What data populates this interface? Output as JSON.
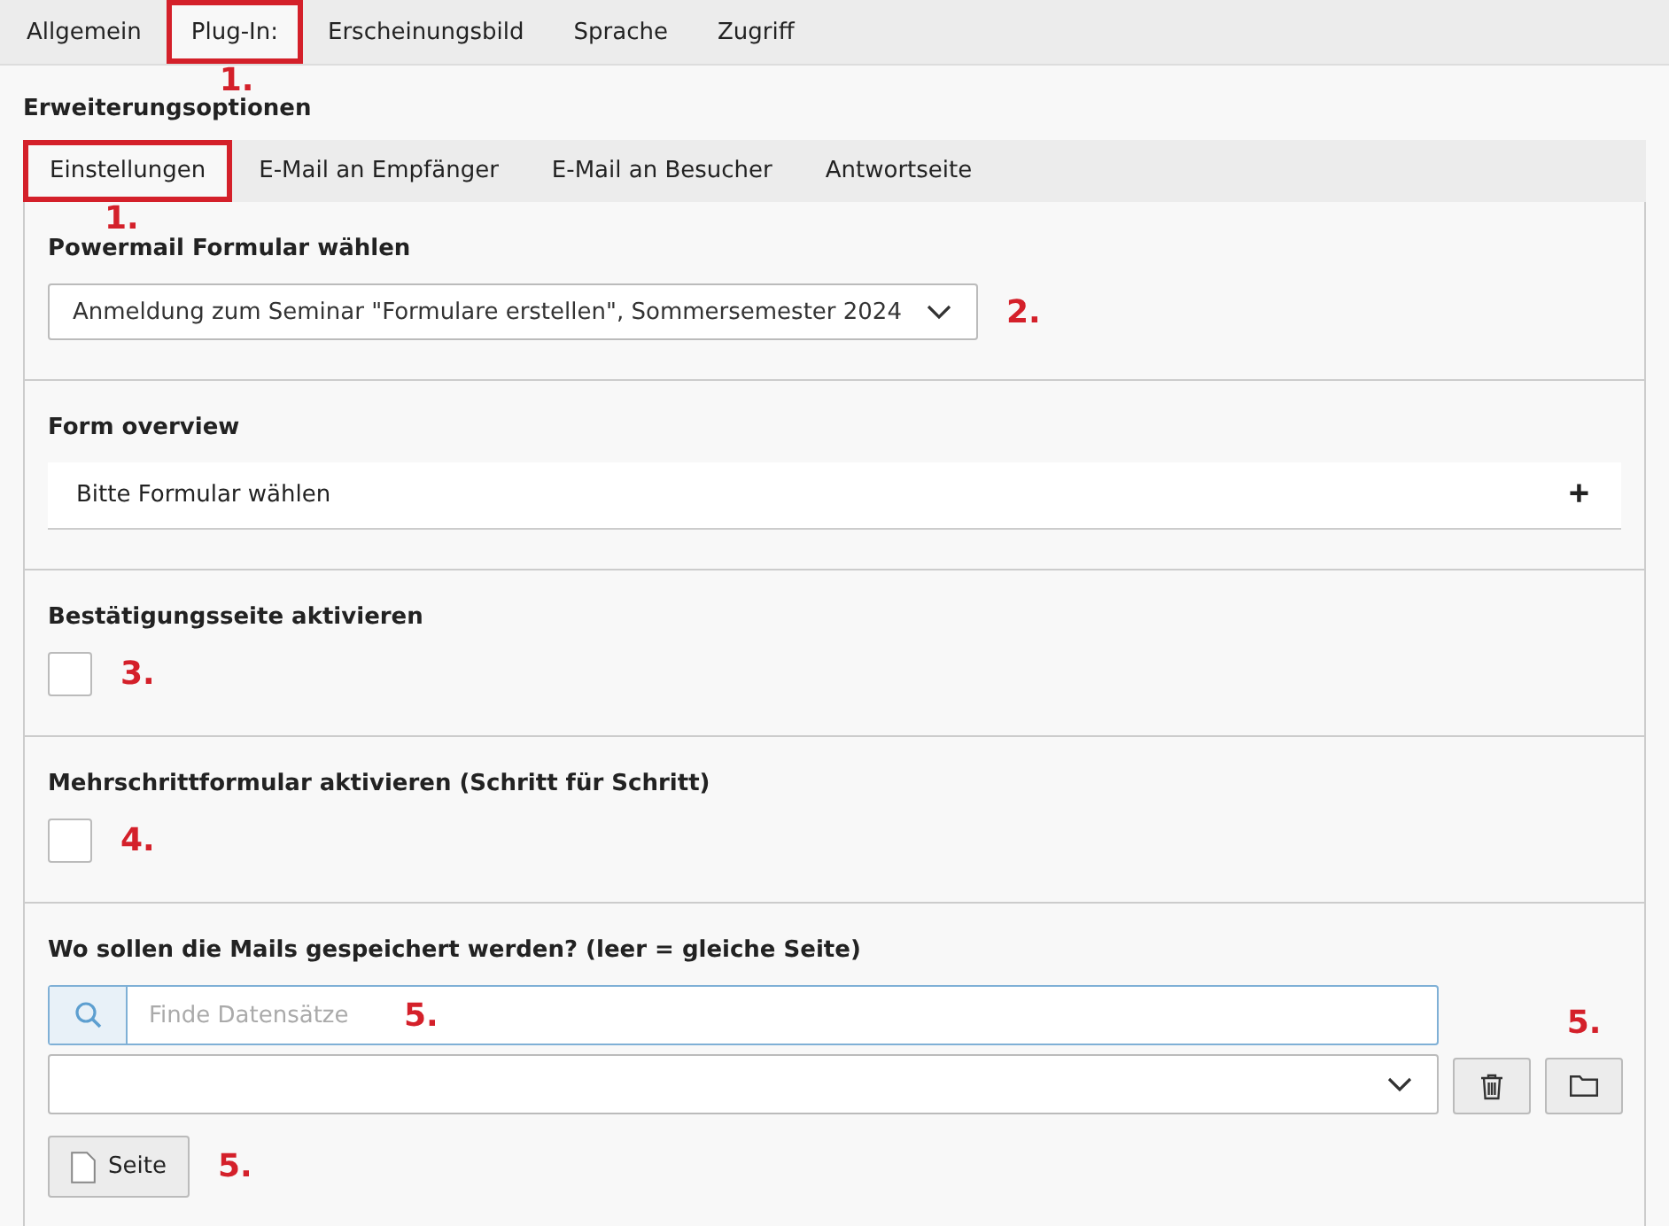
{
  "main_tabs": [
    {
      "label": "Allgemein",
      "selected": false
    },
    {
      "label": "Plug-In:",
      "selected": true,
      "marker": "1."
    },
    {
      "label": "Erscheinungsbild",
      "selected": false
    },
    {
      "label": "Sprache",
      "selected": false
    },
    {
      "label": "Zugriff",
      "selected": false
    }
  ],
  "heading": "Erweiterungsoptionen",
  "sub_tabs": [
    {
      "label": "Einstellungen",
      "selected": true,
      "marker": "1."
    },
    {
      "label": "E-Mail an Empfänger",
      "selected": false
    },
    {
      "label": "E-Mail an Besucher",
      "selected": false
    },
    {
      "label": "Antwortseite",
      "selected": false
    }
  ],
  "sections": [
    {
      "kind": "select",
      "label": "Powermail Formular wählen",
      "value": "Anmeldung zum Seminar \"Formulare erstellen\", Sommersemester 2024",
      "marker": "2."
    },
    {
      "kind": "overview",
      "label": "Form overview",
      "row": "Bitte Formular wählen",
      "toggle": "+"
    },
    {
      "kind": "checkbox",
      "label": "Bestätigungsseite aktivieren",
      "checked": false,
      "marker": "3."
    },
    {
      "kind": "checkbox",
      "label": "Mehrschrittformular aktivieren (Schritt für Schritt)",
      "checked": false,
      "marker": "4."
    },
    {
      "kind": "records",
      "label": "Wo sollen die Mails gespeichert werden? (leer = gleiche Seite)",
      "placeholder": "Finde Datensätze",
      "search_marker": "5.",
      "buttons_marker": "5.",
      "page_button": "Seite",
      "page_marker": "5."
    }
  ]
}
